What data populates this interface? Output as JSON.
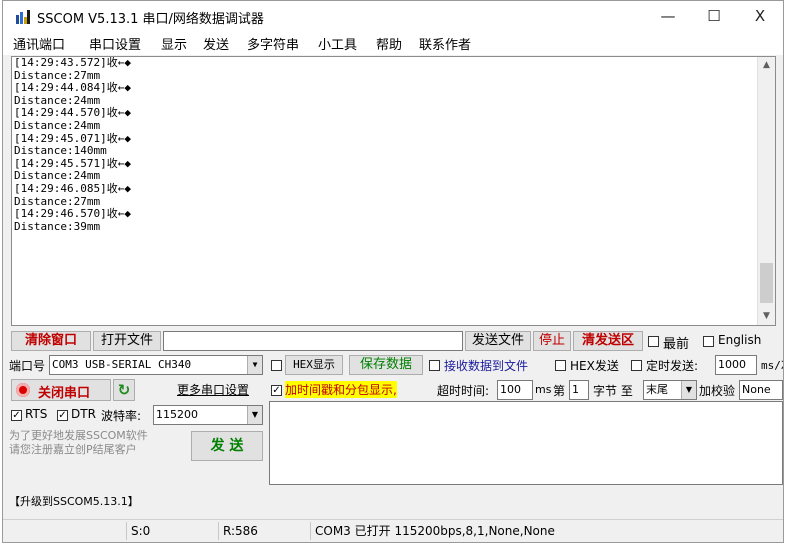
{
  "window": {
    "title": "SSCOM V5.13.1 串口/网络数据调试器",
    "minimize": "—",
    "maximize": "☐",
    "close": "X"
  },
  "menu": [
    "通讯端口",
    "串口设置",
    "显示",
    "发送",
    "多字符串",
    "小工具",
    "帮助",
    "联系作者"
  ],
  "receive": {
    "lines": [
      "[14:29:43.572]收←◆",
      "Distance:27mm",
      "[14:29:44.084]收←◆",
      "Distance:24mm",
      "[14:29:44.570]收←◆",
      "Distance:24mm",
      "[14:29:45.071]收←◆",
      "Distance:140mm",
      "[14:29:45.571]收←◆",
      "Distance:24mm",
      "[14:29:46.085]收←◆",
      "Distance:27mm",
      "[14:29:46.570]收←◆",
      "Distance:39mm"
    ]
  },
  "toolbar": {
    "clear_window": "清除窗口",
    "open_file": "打开文件",
    "send_file": "发送文件",
    "stop": "停止",
    "clear_send": "清发送区",
    "front": "最前",
    "english": "English"
  },
  "port": {
    "label": "端口号",
    "value": "COM3 USB-SERIAL CH340",
    "hex_display": "HEX显示",
    "save_data": "保存数据",
    "recv_to_file": "接收数据到文件",
    "hex_send": "HEX发送",
    "timed_send": "定时发送:",
    "timed_value": "1000",
    "timed_unit": "ms/次"
  },
  "controls": {
    "close_port": "关闭串口",
    "more_settings": "更多串口设置",
    "timestamp": "加时间戳和分包显示,",
    "timeout_label": "超时时间:",
    "timeout_value": "100",
    "timeout_unit": "ms",
    "nth_label": "第",
    "nth_value": "1",
    "byte_label": "字节 至",
    "end_value": "末尾",
    "checksum_label": "加校验",
    "checksum_value": "None"
  },
  "signals": {
    "rts": "RTS",
    "dtr": "DTR",
    "baud_label": "波特率:",
    "baud_value": "115200"
  },
  "promo": {
    "line1": "为了更好地发展SSCOM软件",
    "line2": "请您注册嘉立创P结尾客户",
    "send": "发 送"
  },
  "upgrade": "【升级到SSCOM5.13.1】",
  "status": {
    "s": "S:0",
    "r": "R:586",
    "port_status": "COM3 已打开  115200bps,8,1,None,None"
  }
}
